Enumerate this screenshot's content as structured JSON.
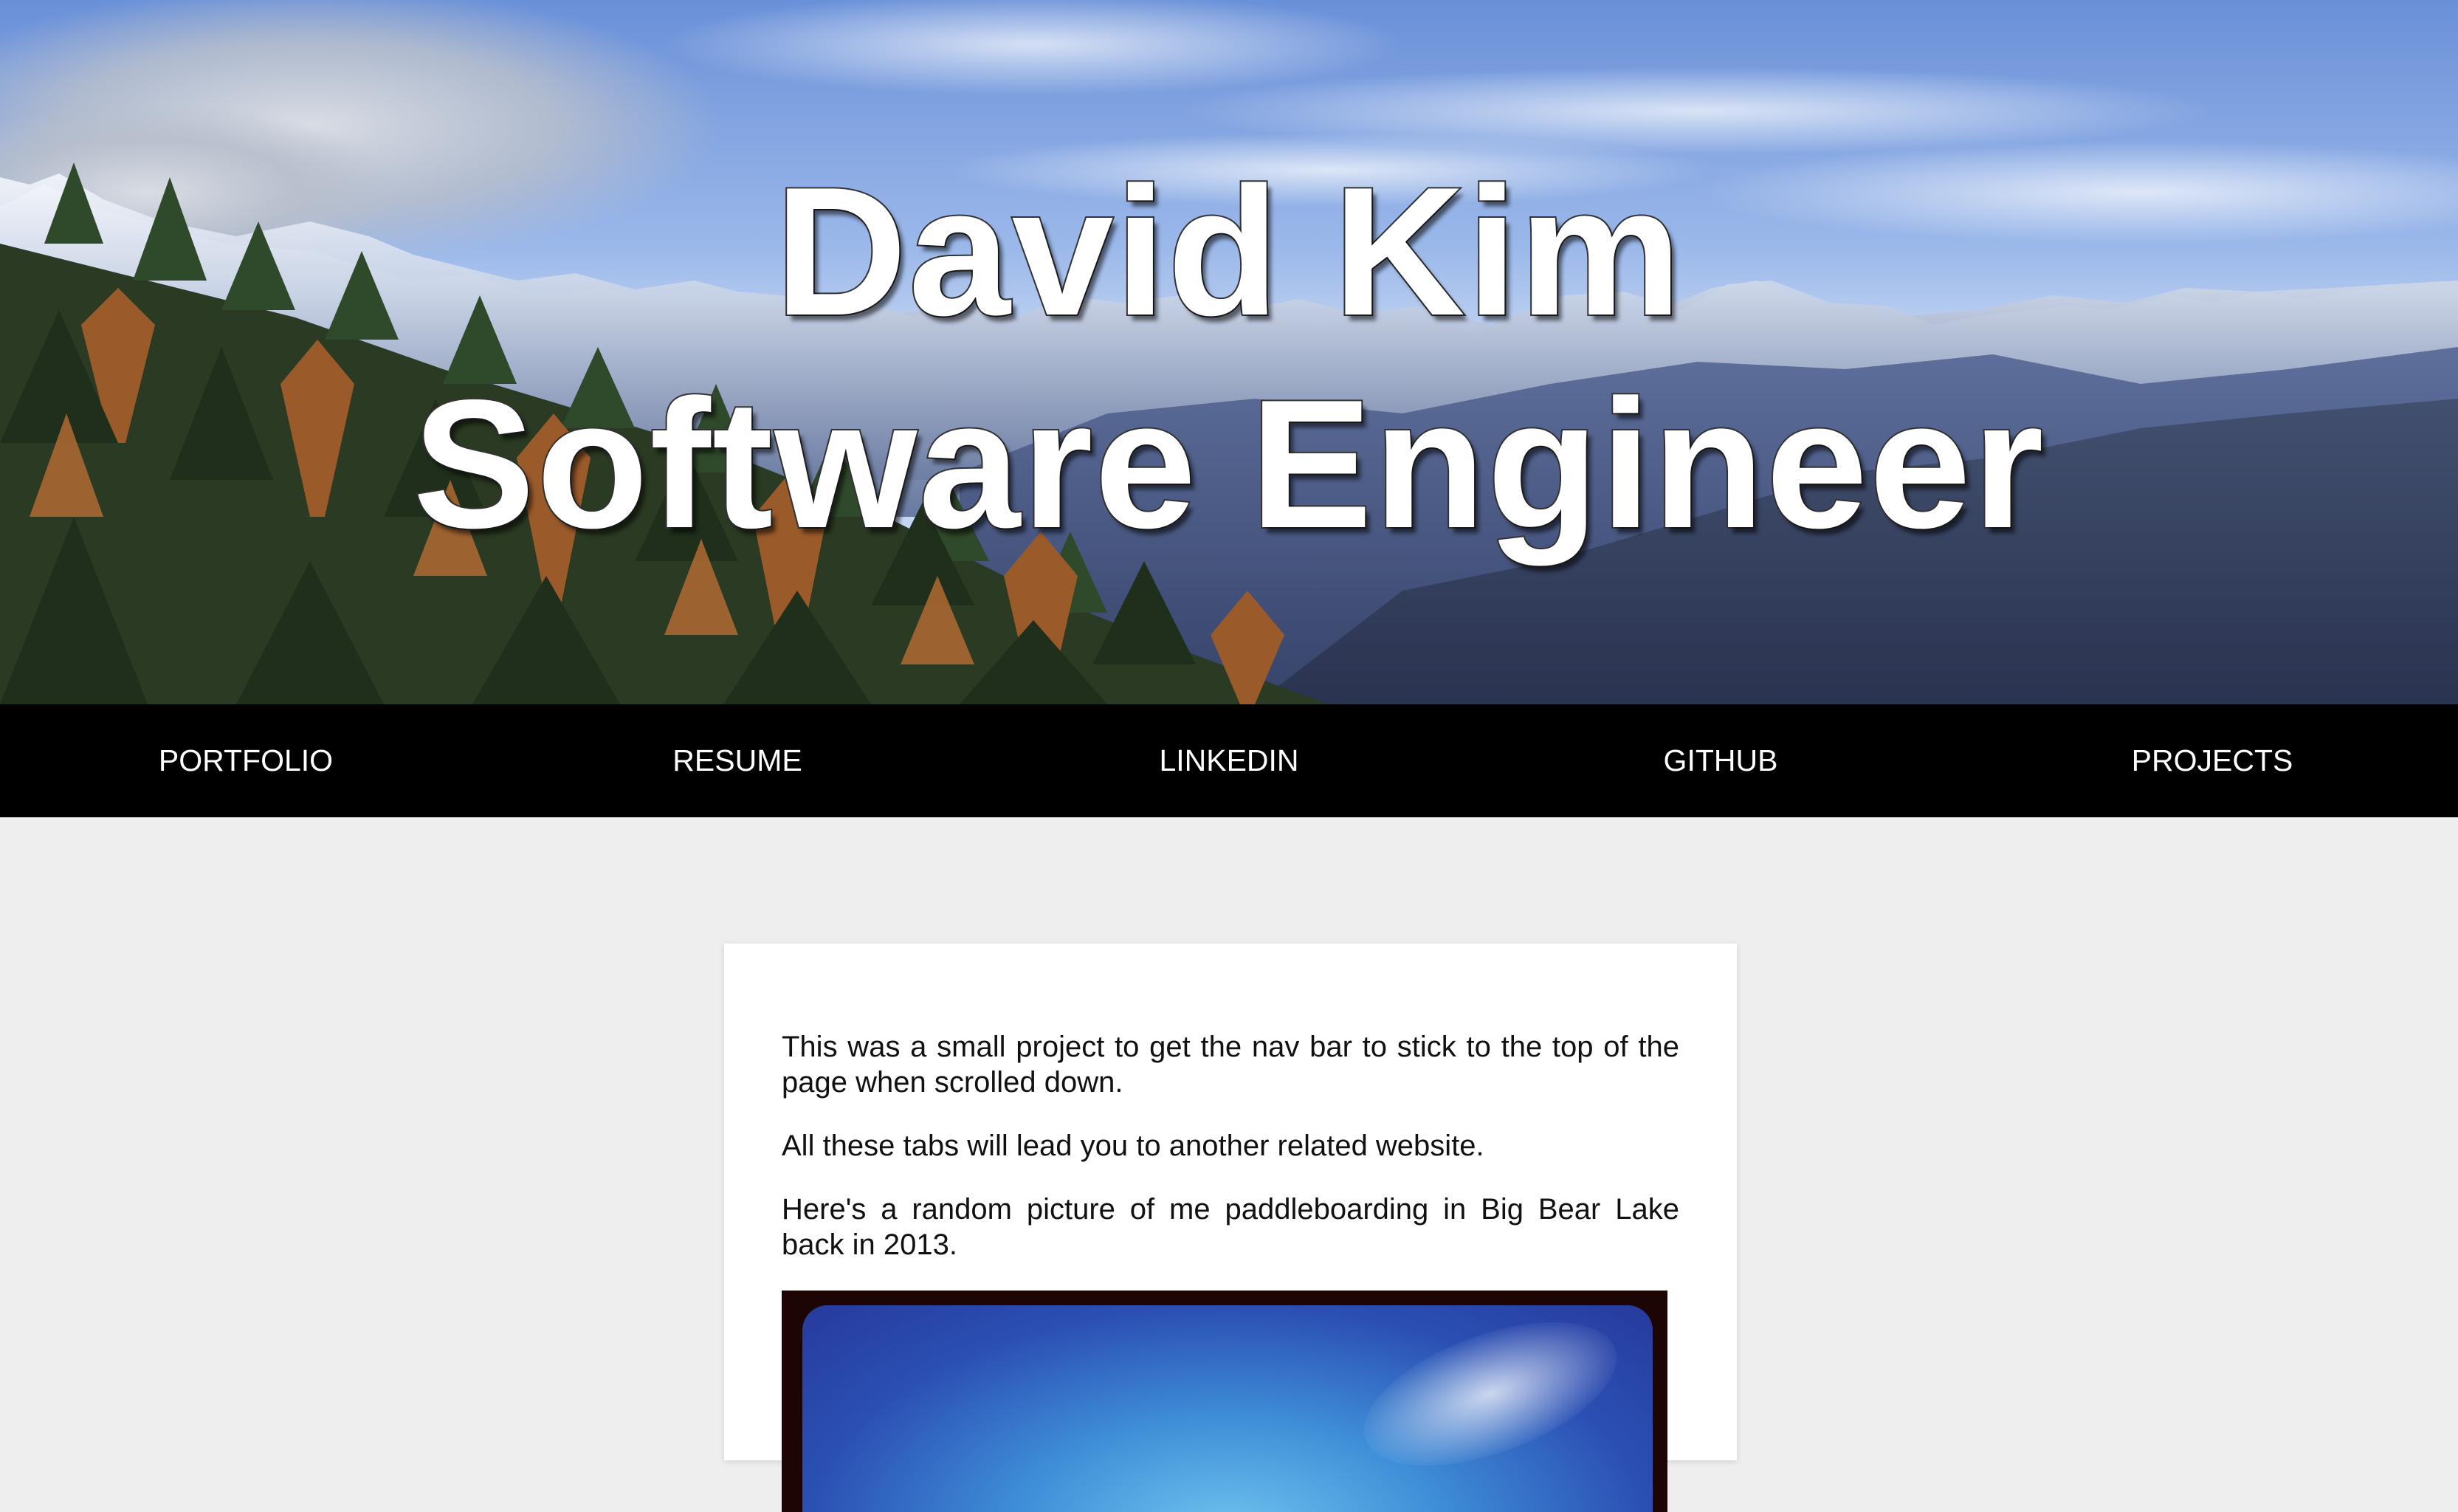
{
  "hero": {
    "name": "David Kim",
    "role": "Software Engineer"
  },
  "nav": {
    "items": [
      {
        "label": "PORTFOLIO"
      },
      {
        "label": "RESUME"
      },
      {
        "label": "LINKEDIN"
      },
      {
        "label": "GITHUB"
      },
      {
        "label": "PROJECTS"
      }
    ]
  },
  "content": {
    "paragraphs": [
      "This was a small project to get the nav bar to stick to the top of the page when scrolled down.",
      "All these tabs will lead you to another related website.",
      "Here's a random picture of me paddleboarding in Big Bear Lake back in 2013."
    ]
  },
  "colors": {
    "nav_background": "#000000",
    "page_background": "#eeeeee",
    "card_background": "#ffffff",
    "title_fill": "#ffffff"
  }
}
